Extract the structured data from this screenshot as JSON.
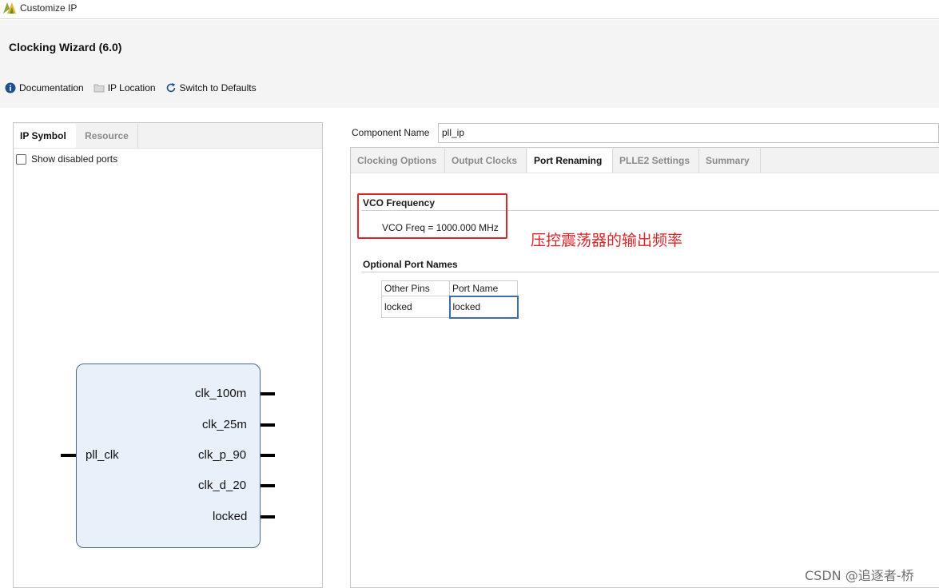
{
  "window": {
    "title": "Customize IP"
  },
  "header": {
    "wizard_title": "Clocking Wizard (6.0)"
  },
  "toolbar": {
    "documentation": "Documentation",
    "ip_location": "IP Location",
    "switch_defaults": "Switch to Defaults"
  },
  "left_panel": {
    "tabs": [
      "IP Symbol",
      "Resource"
    ],
    "active_tab": "IP Symbol",
    "show_disabled_label": "Show disabled ports",
    "show_disabled_checked": false
  },
  "ip_symbol": {
    "inputs": [
      "pll_clk"
    ],
    "outputs": [
      "clk_100m",
      "clk_25m",
      "clk_p_90",
      "clk_d_20",
      "locked"
    ]
  },
  "component": {
    "label": "Component Name",
    "value": "pll_ip"
  },
  "right_tabs": {
    "items": [
      "Clocking Options",
      "Output Clocks",
      "Port Renaming",
      "PLLE2 Settings",
      "Summary"
    ],
    "active": "Port Renaming"
  },
  "vco": {
    "title": "VCO Frequency",
    "value_text": "VCO Freq = 1000.000 MHz"
  },
  "annotation": {
    "text": "压控震荡器的输出频率",
    "color": "#d9262b"
  },
  "optional_ports": {
    "title": "Optional Port Names",
    "headers": [
      "Other Pins",
      "Port Name"
    ],
    "rows": [
      [
        "locked",
        "locked"
      ]
    ]
  },
  "watermark": {
    "text": "CSDN @追逐者-桥"
  },
  "colors": {
    "accent": "#3d6ea8",
    "ip_block_fill": "#e8f1fa",
    "highlight_red": "#d9262b"
  }
}
